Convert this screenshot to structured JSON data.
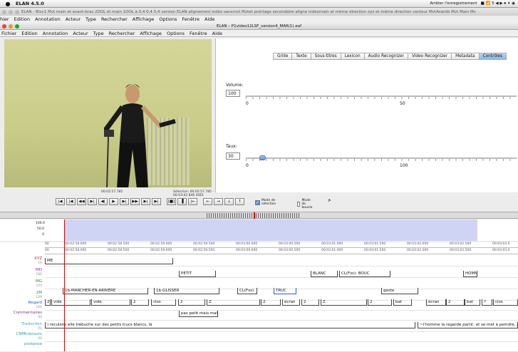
{
  "mac_menubar": {
    "app_name": "ELAN 4.5.0",
    "recording": "Arrêter l'enregistrement",
    "status_glyphs": "■ 📶 5 ◀ ▶ ⏺ ✦ ◉"
  },
  "window1": {
    "title": "ELAN - Bloc1 Mvt main et avant-bras 2DOL et main 1DOL à 0,4 0,4 0,4 version ELAN alignement index sansmvt Mvtet pointage secondaire aligne indexmain et même direction xyz et même direction vecteur MvtAvantb Mvt Main Mv",
    "menu": [
      "hier",
      "Edition",
      "Annotation",
      "Acteur",
      "Type",
      "Rechercher",
      "Affichage",
      "Options",
      "Fenêtre",
      "Aide"
    ]
  },
  "window2": {
    "title": "ELAN – P1video12LSF_version4_MAR(1).eaf",
    "menu": [
      "Fichier",
      "Edition",
      "Annotation",
      "Acteur",
      "Type",
      "Rechercher",
      "Affichage",
      "Options",
      "Fenêtre",
      "Aide"
    ]
  },
  "tabs": [
    "Grille",
    "Texte",
    "Sous-titres",
    "Lexicon",
    "Audio Recognizer",
    "Video Recognizer",
    "Metadata",
    "Contrôles"
  ],
  "active_tab": "Contrôles",
  "volume": {
    "label": "Volume:",
    "value": "100",
    "min_label": "0",
    "mid_label": "50",
    "level": 1.0
  },
  "rate": {
    "label": "Taux:",
    "value": "30",
    "min_label": "0",
    "mid_label": "100",
    "level": 0.3
  },
  "media": {
    "current_time": "00:02:57.785",
    "selection": "Sélection: 00:02:57.785 - 00:03:02.846  4061",
    "buttons": [
      "|◀",
      "|◀",
      "◀◀",
      "▶|",
      "◀|",
      "▶",
      "▶|",
      "▶▶",
      "▶|",
      "▶|",
      "[■]",
      "▐",
      "|←",
      "←",
      "→",
      "↓",
      "↑"
    ],
    "selection_mode": "Mode de sélection",
    "loop_mode": "Mode de boucle"
  },
  "wave": {
    "y_labels": [
      "100.0",
      "50.0",
      "0"
    ]
  },
  "ruler1": [
    "00",
    "00:02:58.000",
    "00:02:58.500",
    "00:02:59.000",
    "00:02:59.500",
    "00:03:00.000",
    "00:03:00.500",
    "00:03:01.000",
    "00:03:01.500",
    "00:03:02.000",
    "00:03:02.500",
    "00:03:03.0"
  ],
  "ruler2": [
    "00",
    "00:02:58.000",
    "00:02:58.500",
    "00:02:59.000",
    "00:02:59.500",
    "00:03:00.000",
    "00:03:00.500",
    "00:03:01.000",
    "00:03:01.500",
    "00:03:02.000",
    "00:03:02.500",
    "00:03:03.0"
  ],
  "tiers": [
    {
      "name": "XYZ",
      "sub": "[3]",
      "color": "#c02020"
    },
    {
      "name": "MD",
      "sub": "[16]",
      "color": "#8a2aa0"
    },
    {
      "name": "MG",
      "sub": "[15]",
      "color": "#2a8a2a"
    },
    {
      "name": "2M",
      "sub": "[19]",
      "color": "#2a8a2a"
    },
    {
      "name": "Regard",
      "sub": "[44]",
      "color": "#3557c6"
    },
    {
      "name": "Commentaires",
      "sub": "[6]",
      "color": "#8a2aa0"
    },
    {
      "name": "Traduction",
      "sub": "[5]",
      "color": "#3aa0c0"
    },
    {
      "name": "CNMtrainsuiv",
      "sub": "[0]",
      "color": "#2aa0a0"
    },
    {
      "name": "postpose",
      "sub": "",
      "color": "#2aa0a0"
    }
  ],
  "annotations": {
    "xyz": [
      "ME"
    ],
    "md": [
      "PETIT",
      "BLANC",
      "CL(Fss): BOUC",
      "HOMM"
    ],
    "twom": [
      "1b-MARCHER-EN-ARRIÈRE",
      "1b-GLISSER",
      "CL(Fss)",
      "TRUC",
      "geste"
    ],
    "regard": [
      "2",
      "vide",
      "vide",
      "2",
      "clos",
      "2",
      "Z",
      "2",
      "écran",
      "2",
      "Z",
      "2",
      "bat",
      "écran",
      "2",
      "bat",
      "?",
      "clos"
    ],
    "commentaires": [
      "pas petit mais mala"
    ],
    "traduction": [
      ") reculons elle trébuche sur des petits trucs blancs, là",
      "~l'homme la regarde partir, et se met à peindre, avec"
    ]
  }
}
